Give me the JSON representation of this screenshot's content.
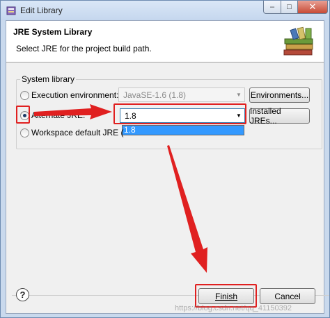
{
  "window": {
    "title": "Edit Library",
    "icon": "eclipse-library-icon",
    "controls": {
      "minimize": "–",
      "maximize": "□",
      "close": "✕"
    }
  },
  "header": {
    "title": "JRE System Library",
    "description": "Select JRE for the project build path.",
    "icon": "books-library-icon"
  },
  "group": {
    "label": "System library",
    "execution_environment": {
      "label": "Execution environment:",
      "value": "JavaSE-1.6 (1.8)",
      "button": "Environments...",
      "checked": false
    },
    "alternate_jre": {
      "label": "Alternate JRE:",
      "value": "1.8",
      "button": "Installed JREs...",
      "checked": true,
      "dropdown_options": [
        "1.8"
      ]
    },
    "workspace_default": {
      "label": "Workspace default JRE (",
      "checked": false
    }
  },
  "footer": {
    "help_label": "?",
    "finish_label": "Finish",
    "cancel_label": "Cancel"
  },
  "annotation_color": "#e02020",
  "watermark": "https://blog.csdn.net/qq_41150392"
}
